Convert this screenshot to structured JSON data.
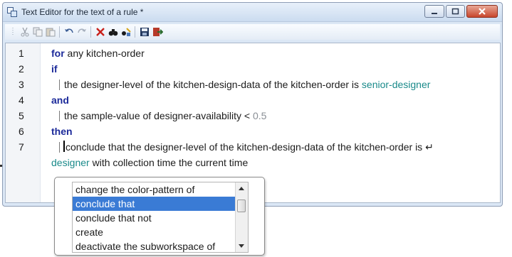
{
  "window": {
    "title": "Text Editor for the text of a rule *"
  },
  "toolbar": {
    "icons": [
      "cut-icon",
      "copy-icon",
      "paste-icon",
      "undo-icon",
      "redo-icon",
      "delete-icon",
      "find-icon",
      "replace-icon",
      "save-icon",
      "exit-icon"
    ]
  },
  "editor": {
    "line_numbers": [
      "1",
      "2",
      "3",
      "4",
      "5",
      "6",
      "7"
    ],
    "lines": {
      "l1": {
        "kw": "for",
        "text": " any kitchen-order"
      },
      "l2": {
        "kw": "if"
      },
      "l3": {
        "text": "the designer-level of the kitchen-design-data of the kitchen-order is ",
        "sym": "senior-designer"
      },
      "l4": {
        "kw": "and"
      },
      "l5": {
        "text": "the sample-value of designer-availability < ",
        "num": "0.5"
      },
      "l6": {
        "kw": "then"
      },
      "l7": {
        "text": "conclude that the designer-level of the kitchen-design-data of the kitchen-order is",
        "wrap_mark": "↵",
        "cont_sym": "designer",
        "cont_text": " with collection time the current time"
      }
    }
  },
  "autocomplete": {
    "options": [
      "change the color-pattern of",
      "conclude that",
      "conclude that not",
      "create",
      "deactivate the subworkspace of"
    ],
    "selected": "conclude that"
  },
  "colors": {
    "keyword": "#1c2a9a",
    "symbol": "#1a8a8a",
    "number": "#8a8f96",
    "selection": "#3a7bd5"
  }
}
